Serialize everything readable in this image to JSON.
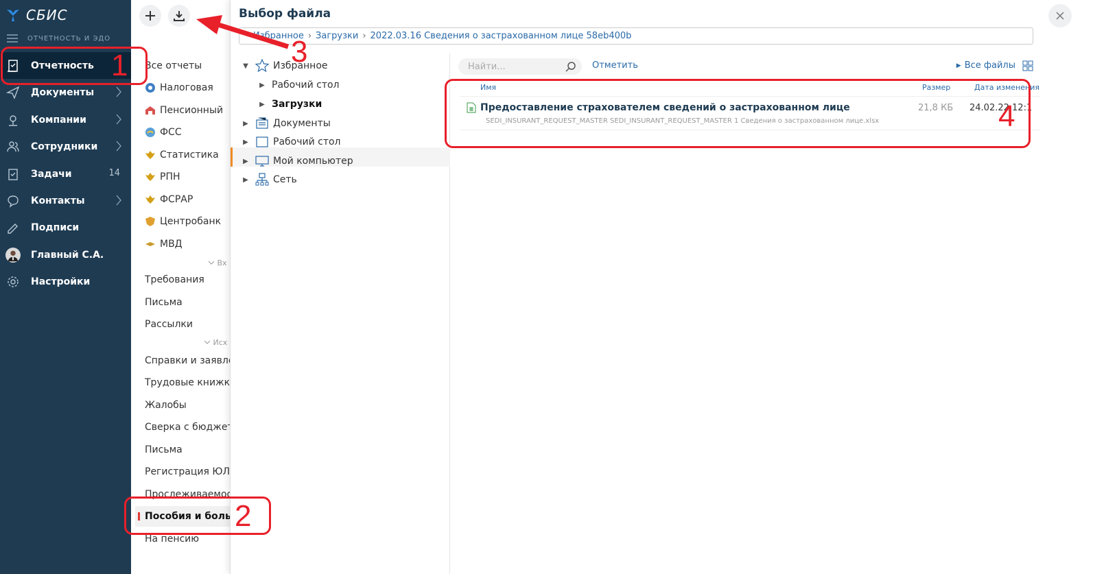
{
  "brand": {
    "name": "СБИС",
    "section": "ОТЧЕТНОСТЬ И ЭДО"
  },
  "nav": {
    "items": [
      {
        "label": "Отчетность",
        "icon": "report-icon"
      },
      {
        "label": "Документы",
        "icon": "send-icon"
      },
      {
        "label": "Компании",
        "icon": "location-icon"
      },
      {
        "label": "Сотрудники",
        "icon": "people-icon"
      },
      {
        "label": "Задачи",
        "icon": "tasks-icon",
        "count": "14"
      },
      {
        "label": "Контакты",
        "icon": "chat-icon"
      },
      {
        "label": "Подписи",
        "icon": "signature-icon"
      },
      {
        "label": "Главный С.А.",
        "icon": "avatar"
      },
      {
        "label": "Настройки",
        "icon": "gear-icon"
      }
    ]
  },
  "registry": {
    "items": [
      "Все отчеты",
      "Налоговая",
      "Пенсионный",
      "ФСС",
      "Статистика",
      "РПН",
      "ФСРАР",
      "Центробанк",
      "МВД"
    ],
    "group_in": "Вх",
    "in_items": [
      "Требования",
      "Письма",
      "Рассылки"
    ],
    "group_out": "Исх",
    "out_items": [
      "Справки и заявлени",
      "Трудовые книжки",
      "Жалобы",
      "Сверка с бюджетом",
      "Письма",
      "Регистрация ЮЛ/И",
      "Прослеживаемость",
      "Пособия и больнич",
      "На пенсию"
    ]
  },
  "dialog": {
    "title": "Выбор файла",
    "path": [
      "Избранное",
      "Загрузки",
      "2022.03.16 Сведения о застрахованном лице 58eb400b"
    ],
    "tree": [
      {
        "label": "Избранное",
        "icon": "star-icon"
      },
      {
        "label": "Рабочий стол"
      },
      {
        "label": "Загрузки"
      },
      {
        "label": "Документы",
        "icon": "documents-icon"
      },
      {
        "label": "Рабочий стол",
        "icon": "desktop-icon"
      },
      {
        "label": "Мой компьютер",
        "icon": "computer-icon"
      },
      {
        "label": "Сеть",
        "icon": "network-icon"
      }
    ],
    "search_placeholder": "Найти...",
    "mark_label": "Отметить",
    "all_files_label": "Все файлы",
    "columns": {
      "name": "Имя",
      "size": "Размер",
      "date": "Дата изменения"
    },
    "file": {
      "name": "Предоставление страхователем сведений о застрахованном лице",
      "sub": "SEDI_INSURANT_REQUEST_MASTER SEDI_INSURANT_REQUEST_MASTER 1 Сведения о застрахованном лице.xlsx",
      "size": "21,8 КБ",
      "date": "24.02.22 12:1"
    }
  },
  "annotations": [
    "1",
    "2",
    "3",
    "4"
  ],
  "colors": {
    "nav_bg": "#1e3b52",
    "accent": "#2a6aa8",
    "annotation": "#e8202a",
    "selection": "#f08a24"
  }
}
